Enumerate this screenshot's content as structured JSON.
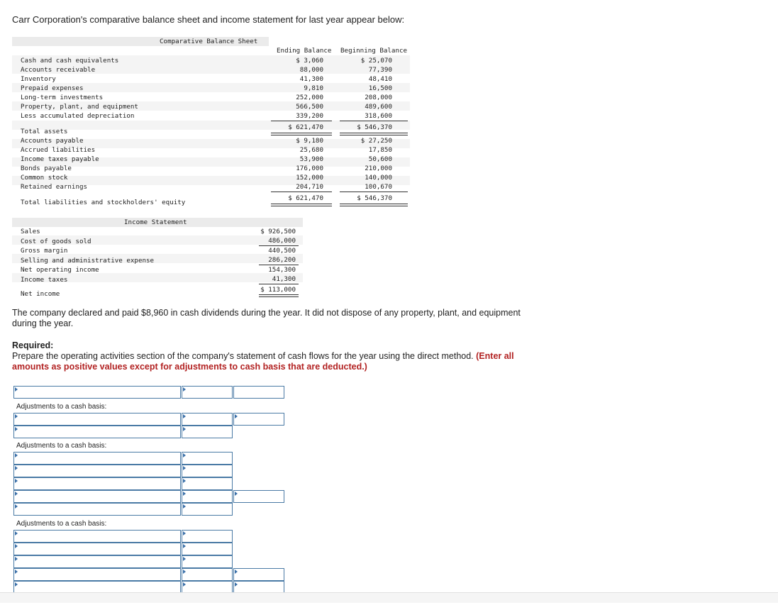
{
  "intro": "Carr Corporation's comparative balance sheet and income statement for last year appear below:",
  "balance_sheet": {
    "title": "Comparative Balance Sheet",
    "col1_header": "Ending Balance",
    "col2_header": "Beginning Balance",
    "assets": [
      {
        "label": "Cash and cash equivalents",
        "end": "$ 3,060",
        "begin": "$ 25,070"
      },
      {
        "label": "Accounts receivable",
        "end": "88,000",
        "begin": "77,390"
      },
      {
        "label": "Inventory",
        "end": "41,300",
        "begin": "48,410"
      },
      {
        "label": "Prepaid expenses",
        "end": "9,810",
        "begin": "16,500"
      },
      {
        "label": "Long-term investments",
        "end": "252,000",
        "begin": "208,000"
      },
      {
        "label": "Property, plant, and equipment",
        "end": "566,500",
        "begin": "489,600"
      },
      {
        "label": "Less accumulated depreciation",
        "end": "339,200",
        "begin": "318,600"
      }
    ],
    "total_assets": {
      "label": "Total assets",
      "end": "$ 621,470",
      "begin": "$ 546,370"
    },
    "liabilities": [
      {
        "label": "Accounts payable",
        "end": "$ 9,180",
        "begin": "$ 27,250"
      },
      {
        "label": "Accrued liabilities",
        "end": "25,680",
        "begin": "17,850"
      },
      {
        "label": "Income taxes payable",
        "end": "53,900",
        "begin": "50,600"
      },
      {
        "label": "Bonds payable",
        "end": "176,000",
        "begin": "210,000"
      },
      {
        "label": "Common stock",
        "end": "152,000",
        "begin": "140,000"
      },
      {
        "label": "Retained earnings",
        "end": "204,710",
        "begin": "100,670"
      }
    ],
    "total_liabilities": {
      "label": "Total liabilities and stockholders' equity",
      "end": "$ 621,470",
      "begin": "$ 546,370"
    }
  },
  "income_statement": {
    "title": "Income Statement",
    "rows": [
      {
        "label": "Sales",
        "value": "$ 926,500"
      },
      {
        "label": "Cost of goods sold",
        "value": "486,000"
      },
      {
        "label": "Gross margin",
        "value": "440,500"
      },
      {
        "label": "Selling and administrative expense",
        "value": "286,200"
      },
      {
        "label": "Net operating income",
        "value": "154,300"
      },
      {
        "label": "Income taxes",
        "value": "41,300"
      },
      {
        "label": "Net income",
        "value": "$ 113,000"
      }
    ]
  },
  "paragraph": "The company declared and paid $8,960 in cash dividends during the year. It did not dispose of any property, plant, and equipment during the year.",
  "required": {
    "heading": "Required:",
    "text": "Prepare the operating activities section of the company's statement of cash flows for the year using the direct method.",
    "emphasis": "(Enter all amounts as positive values except for adjustments to cash basis that are deducted.)"
  },
  "answer_table": {
    "adjust_label": "Adjustments to a cash basis:"
  }
}
